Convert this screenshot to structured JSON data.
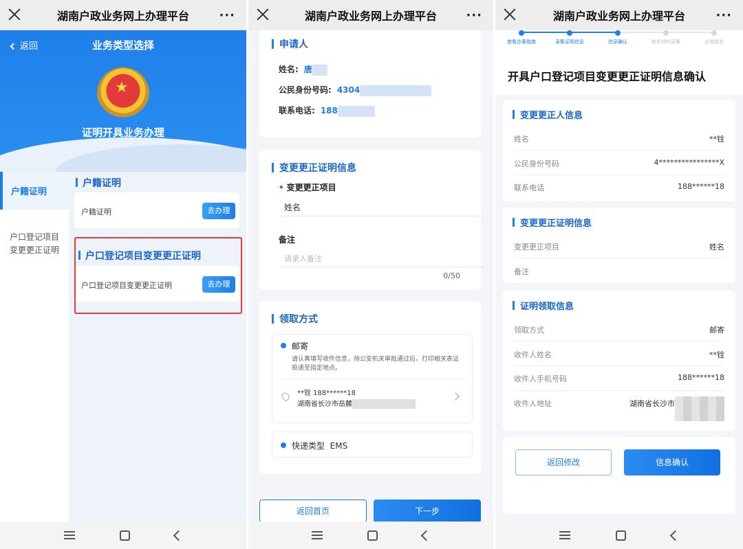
{
  "app_title": "湖南户政业务网上办理平台",
  "more": "···",
  "panel1": {
    "back": "返回",
    "header_title": "业务类型选择",
    "hero_subtitle": "证明开具业务办理",
    "nav_active": "户籍证明",
    "nav_item": "户口登记项目变更更正证明",
    "section1_title": "户籍证明",
    "card1_label": "户籍证明",
    "section2_title": "户口登记项目变更更正证明",
    "card2_label": "户口登记项目变更更正证明",
    "go_button": "去办理"
  },
  "panel2": {
    "applicant_title": "申请人",
    "name_label": "姓名:",
    "name_value": "唐",
    "id_label": "公民身份号码:",
    "id_value": "4304",
    "phone_label": "联系电话:",
    "phone_value": "188",
    "change_title": "变更更正证明信息",
    "item_label": "变更更正项目",
    "item_value": "姓名",
    "remark_label": "备注",
    "remark_placeholder": "请录入备注",
    "remark_counter": "0/50",
    "pickup_title": "领取方式",
    "mail_label": "邮寄",
    "mail_desc": "请认真填写收件信息，待公安机关审批通过后，打印相关表证投递至指定地点。",
    "address_name": "**铨 188******18",
    "address_line": "湖南省长沙市岳麓",
    "express_label": "快递类型",
    "express_value": "EMS",
    "btn_home": "返回首页",
    "btn_next": "下一步"
  },
  "panel3": {
    "steps": [
      "查看办事指南",
      "采集证明信息",
      "信息确认",
      "附件材料采集",
      "业务提交"
    ],
    "current_step": 3,
    "page_heading": "开具户口登记项目变更更正证明信息确认",
    "card1_title": "变更更正人信息",
    "card1_rows": [
      {
        "label": "姓名",
        "value": "**铨"
      },
      {
        "label": "公民身份号码",
        "value": "4****************X"
      },
      {
        "label": "联系电话",
        "value": "188******18"
      }
    ],
    "card2_title": "变更更正证明信息",
    "card2_rows": [
      {
        "label": "变更更正项目",
        "value": "姓名"
      },
      {
        "label": "备注",
        "value": ""
      }
    ],
    "card3_title": "证明领取信息",
    "card3_rows": [
      {
        "label": "领取方式",
        "value": "邮寄"
      },
      {
        "label": "收件人姓名",
        "value": "**铨"
      },
      {
        "label": "收件人手机号码",
        "value": "188******18"
      },
      {
        "label": "收件人地址",
        "value": "湖南省长沙市"
      }
    ],
    "btn_back": "返回修改",
    "btn_confirm": "信息确认"
  },
  "colors": {
    "primary": "#1e7fe9",
    "highlight": "#e23b3b"
  }
}
